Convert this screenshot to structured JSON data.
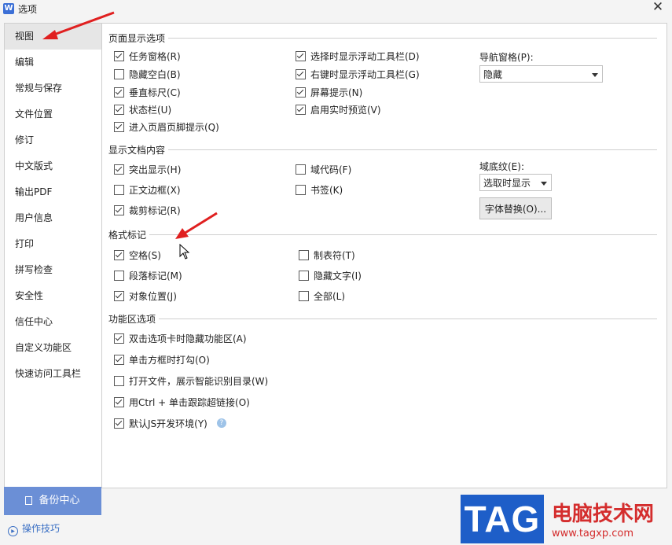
{
  "window": {
    "title": "选项",
    "app_icon": "W",
    "close_glyph": "✕"
  },
  "sidebar": {
    "items": [
      {
        "label": "视图",
        "active": true
      },
      {
        "label": "编辑"
      },
      {
        "label": "常规与保存"
      },
      {
        "label": "文件位置"
      },
      {
        "label": "修订"
      },
      {
        "label": "中文版式"
      },
      {
        "label": "输出PDF"
      },
      {
        "label": "用户信息"
      },
      {
        "label": "打印"
      },
      {
        "label": "拼写检查"
      },
      {
        "label": "安全性"
      },
      {
        "label": "信任中心"
      },
      {
        "label": "自定义功能区"
      },
      {
        "label": "快速访问工具栏"
      }
    ],
    "backup_label": "备份中心",
    "tips_label": "操作技巧"
  },
  "page_display": {
    "title": "页面显示选项",
    "col1": [
      {
        "label": "任务窗格(R)",
        "checked": true
      },
      {
        "label": "隐藏空白(B)",
        "checked": false
      },
      {
        "label": "垂直标尺(C)",
        "checked": true
      },
      {
        "label": "状态栏(U)",
        "checked": true
      },
      {
        "label": "进入页眉页脚提示(Q)",
        "checked": true
      }
    ],
    "col2": [
      {
        "label": "选择时显示浮动工具栏(D)",
        "checked": true
      },
      {
        "label": "右键时显示浮动工具栏(G)",
        "checked": true
      },
      {
        "label": "屏幕提示(N)",
        "checked": true
      },
      {
        "label": "启用实时预览(V)",
        "checked": true
      }
    ],
    "nav_pane_label": "导航窗格(P):",
    "nav_pane_value": "隐藏"
  },
  "doc_content": {
    "title": "显示文档内容",
    "col1": [
      {
        "label": "突出显示(H)",
        "checked": true
      },
      {
        "label": "正文边框(X)",
        "checked": false
      },
      {
        "label": "裁剪标记(R)",
        "checked": true
      }
    ],
    "col2": [
      {
        "label": "域代码(F)",
        "checked": false
      },
      {
        "label": "书签(K)",
        "checked": false
      }
    ],
    "field_shading_label": "域底纹(E):",
    "field_shading_value": "选取时显示",
    "font_replace_label": "字体替换(O)..."
  },
  "format_marks": {
    "title": "格式标记",
    "col1": [
      {
        "label": "空格(S)",
        "checked": true
      },
      {
        "label": "段落标记(M)",
        "checked": false
      },
      {
        "label": "对象位置(J)",
        "checked": true
      }
    ],
    "col2": [
      {
        "label": "制表符(T)",
        "checked": false
      },
      {
        "label": "隐藏文字(I)",
        "checked": false
      },
      {
        "label": "全部(L)",
        "checked": false
      }
    ]
  },
  "ribbon": {
    "title": "功能区选项",
    "items": [
      {
        "label": "双击选项卡时隐藏功能区(A)",
        "checked": true
      },
      {
        "label": "单击方框时打勾(O)",
        "checked": true
      },
      {
        "label": "打开文件，展示智能识别目录(W)",
        "checked": false
      },
      {
        "label": "用Ctrl + 单击跟踪超链接(O)",
        "checked": true
      },
      {
        "label": "默认JS开发环境(Y)",
        "checked": true,
        "help_icon": "?"
      }
    ]
  },
  "watermark": {
    "logo": "TAG",
    "title": "电脑技术网",
    "url": "www.tagxp.com"
  },
  "colors": {
    "accent": "#6b8fd6",
    "arrow": "#e02020",
    "watermark_red": "#d42d2d",
    "watermark_blue": "#1e5ec8"
  }
}
